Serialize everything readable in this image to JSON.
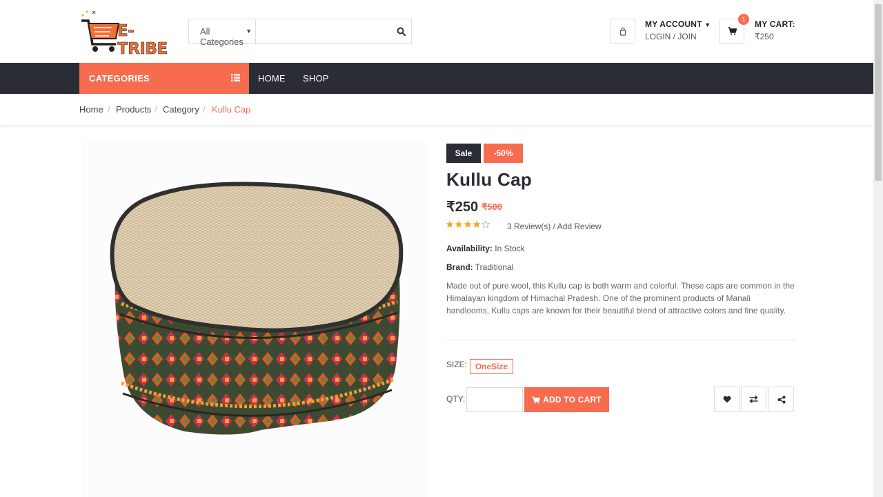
{
  "header": {
    "logo_text": "E-TRIBE",
    "search": {
      "category_selected": "All Categories",
      "placeholder": "",
      "icon": "search-icon"
    },
    "account": {
      "title": "MY ACCOUNT",
      "subtitle": "LOGIN / JOIN",
      "icon": "user-icon"
    },
    "cart": {
      "title": "MY CART:",
      "amount": "₹250",
      "count": "1",
      "icon": "shopping-cart-icon"
    }
  },
  "nav": {
    "categories_label": "CATEGORIES",
    "links": [
      "HOME",
      "SHOP"
    ]
  },
  "breadcrumb": {
    "items": [
      "Home",
      "Products",
      "Category",
      "Kullu Cap"
    ],
    "separator": "/"
  },
  "product": {
    "badges": {
      "sale": "Sale",
      "discount": "-50%"
    },
    "title": "Kullu Cap",
    "price": "₹250",
    "old_price": "₹500",
    "rating": 4,
    "rating_max": 5,
    "reviews_text": "3 Review(s) / Add Review",
    "availability_label": "Availability:",
    "availability_value": "In Stock",
    "brand_label": "Brand:",
    "brand_value": "Traditional",
    "description": "Made out of pure wool, this Kullu cap is both warm and colorful. These caps are common in the Himalayan kingdom of Himachal Pradesh. One of the prominent products of Manali handlooms, Kullu caps are known for their beautiful blend of attractive colors and fine quality.",
    "size_label": "SIZE:",
    "size_option": "OneSize",
    "qty_label": "QTY:",
    "qty_value": "",
    "add_to_cart": "ADD TO CART",
    "actions": [
      "heart-icon",
      "compare-icon",
      "share-icon"
    ]
  },
  "colors": {
    "accent": "#f76c4f",
    "dark": "#2a2d35",
    "star": "#f5a623"
  }
}
